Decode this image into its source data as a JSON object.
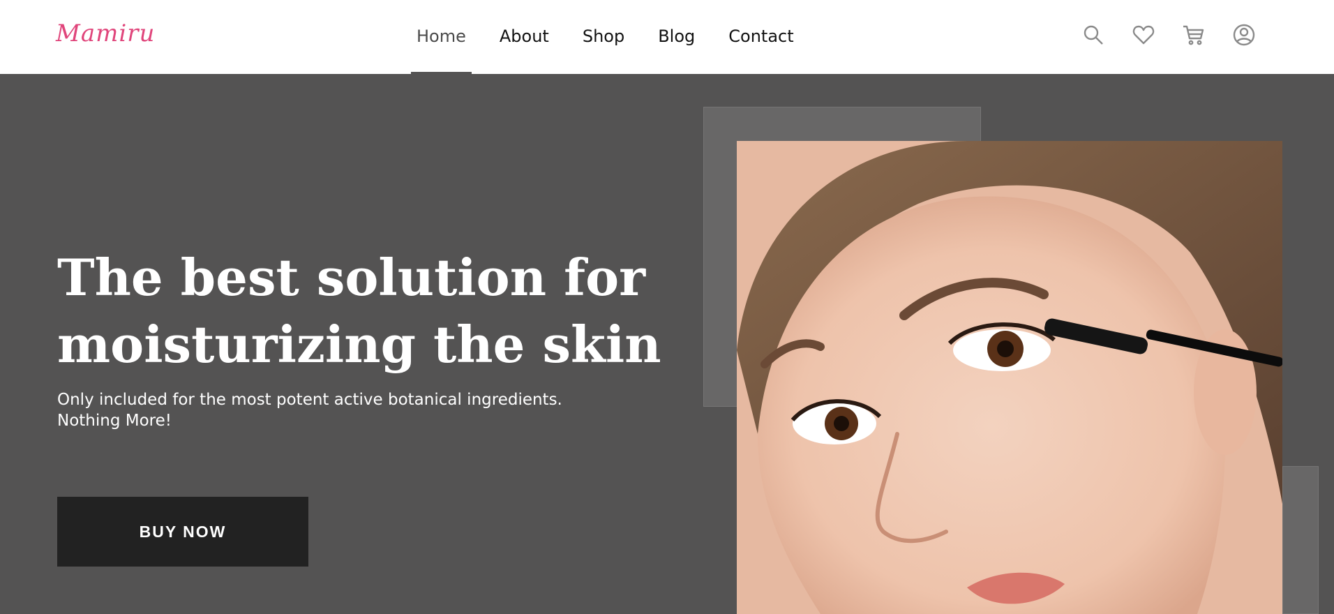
{
  "brand": {
    "logo_text": "Mamiru",
    "accent_color": "#e0457b"
  },
  "nav": {
    "items": [
      {
        "label": "Home",
        "active": true
      },
      {
        "label": "About",
        "active": false
      },
      {
        "label": "Shop",
        "active": false
      },
      {
        "label": "Blog",
        "active": false
      },
      {
        "label": "Contact",
        "active": false
      }
    ]
  },
  "header_icons": [
    "search-icon",
    "heart-icon",
    "cart-icon",
    "user-icon"
  ],
  "hero": {
    "title_line1": "The best solution for",
    "title_line2": "moisturizing the skin",
    "subtitle_line1": "Only included for the most potent active botanical ingredients.",
    "subtitle_line2": "Nothing More!",
    "cta_label": "BUY NOW",
    "background_color": "#545353",
    "image_subject": "woman-applying-mascara"
  }
}
